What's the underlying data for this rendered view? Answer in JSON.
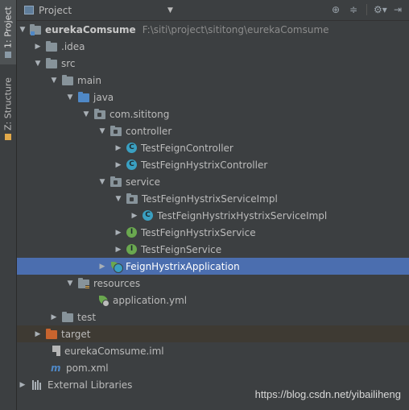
{
  "side_tabs": {
    "project": "1: Project",
    "structure": "Z: Structure"
  },
  "header": {
    "title": "Project",
    "dropdown": "▼",
    "icons": [
      "target-icon",
      "collapse-all-icon",
      "gear-icon",
      "hide-icon"
    ]
  },
  "tree": {
    "root": {
      "name": "eurekaComsume",
      "path": "F:\\siti\\project\\sititong\\eurekaComsume"
    },
    "idea": ".idea",
    "src": "src",
    "main": "main",
    "java": "java",
    "pkg": "com.sititong",
    "controller": "controller",
    "ctrl_classes": [
      "TestFeignController",
      "TestFeignHystrixController"
    ],
    "service": "service",
    "impl_pkg": "TestFeignHystrixServiceImpl",
    "impl_class": "TestFeignHystrixHystrixServiceImpl",
    "interfaces": [
      "TestFeignHystrixService",
      "TestFeignService"
    ],
    "app_class": "FeignHystrixApplication",
    "resources": "resources",
    "yml": "application.yml",
    "test": "test",
    "target": "target",
    "iml": "eurekaComsume.iml",
    "pom": "pom.xml",
    "ext_libs": "External Libraries"
  },
  "watermark": "https://blog.csdn.net/yibailiheng"
}
